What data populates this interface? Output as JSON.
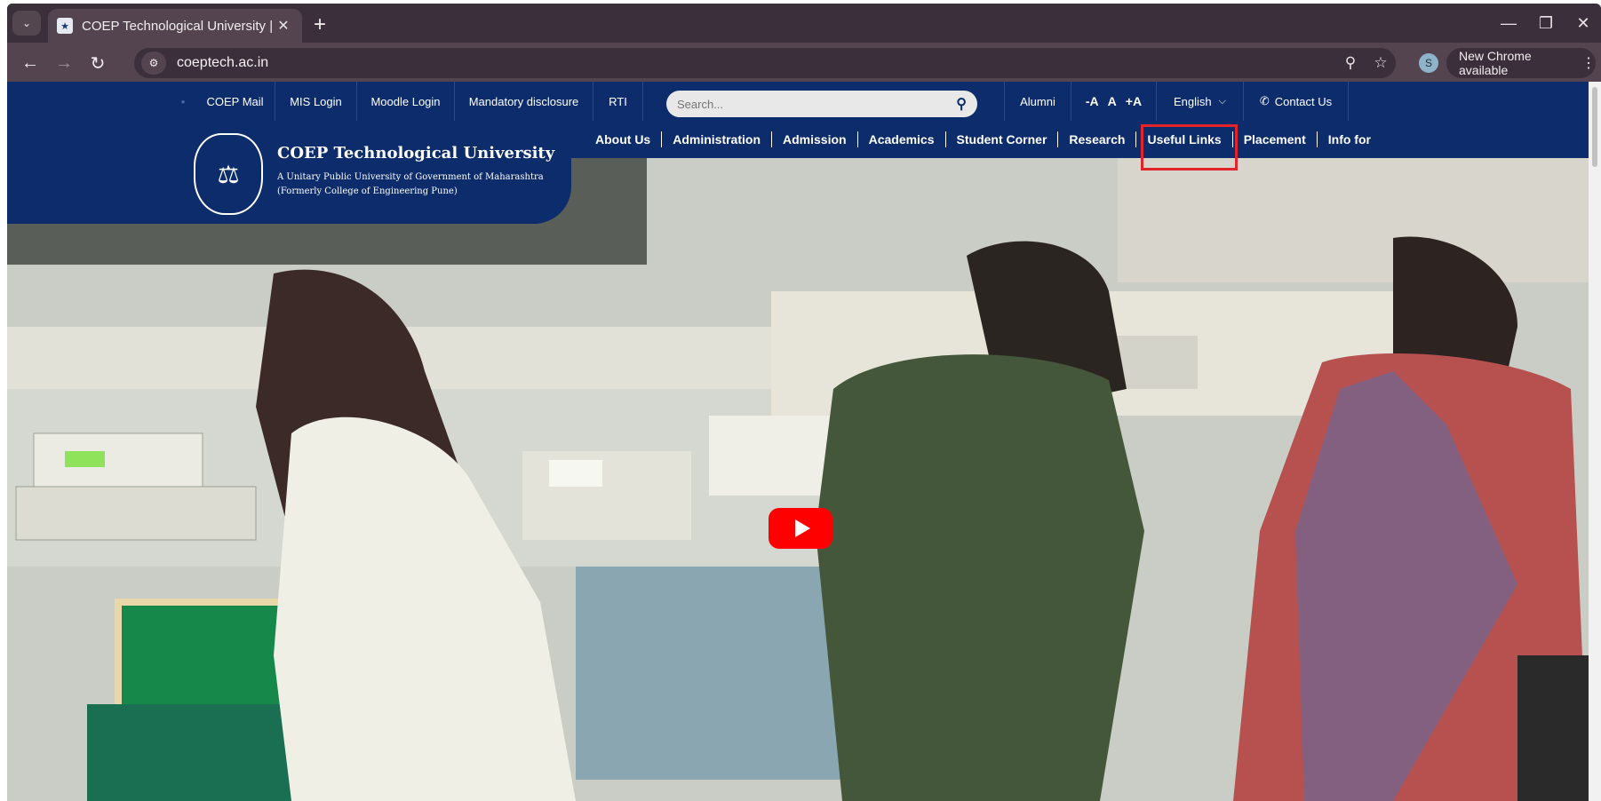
{
  "browser": {
    "tab_title": "COEP Technological University |",
    "url": "coeptech.ac.in",
    "profile_initial": "S",
    "update_label": "New Chrome available"
  },
  "site": {
    "util_links": [
      "COEP Mail",
      "MIS Login",
      "Moodle Login",
      "Mandatory disclosure",
      "RTI"
    ],
    "search_placeholder": "Search...",
    "alumni": "Alumni",
    "font_small": "-A",
    "font_normal": "A",
    "font_large": "+A",
    "language": "English",
    "contact": "Contact Us",
    "university_name": "COEP Technological University",
    "university_subtitle_1": "A Unitary Public University of Government of Maharashtra",
    "university_subtitle_2": "(Formerly College of Engineering Pune)",
    "nav": [
      "About Us",
      "Administration",
      "Admission",
      "Academics",
      "Student Corner",
      "Research",
      "Useful Links",
      "Placement",
      "Info for"
    ]
  },
  "colors": {
    "brand_navy": "#0d2c6b",
    "highlight_red": "#e1252a",
    "youtube_red": "#ff0000"
  }
}
